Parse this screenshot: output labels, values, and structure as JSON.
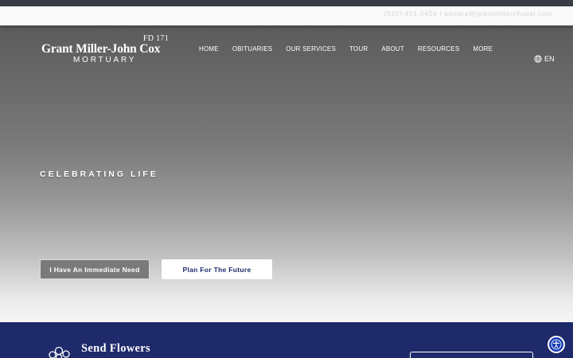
{
  "contact": {
    "phone": "(510) 451-6434",
    "separator": "|",
    "email": "wecare@grantmillerchapel.com"
  },
  "logo": {
    "license": "FD 171",
    "name": "Grant Miller-John Cox",
    "subtitle": "MORTUARY"
  },
  "nav": {
    "items": [
      {
        "label": "HOME"
      },
      {
        "label": "OBITUARIES"
      },
      {
        "label": "OUR SERVICES"
      },
      {
        "label": "TOUR"
      },
      {
        "label": "ABOUT"
      },
      {
        "label": "RESOURCES"
      },
      {
        "label": "MORE"
      }
    ]
  },
  "language": {
    "icon": "globe-icon",
    "code": "EN"
  },
  "hero": {
    "tagline": "CELEBRATING LIFE",
    "buttons": {
      "immediate": "I Have An Immediate Need",
      "future": "Plan For The Future"
    }
  },
  "flowers": {
    "icon": "flower-bouquet-icon",
    "title": "Send Flowers"
  },
  "accessibility": {
    "icon": "accessibility-icon"
  },
  "colors": {
    "navy": "#1f2a6b",
    "accessibility_blue": "#1b3db5",
    "button_text": "#1c2b6b"
  }
}
